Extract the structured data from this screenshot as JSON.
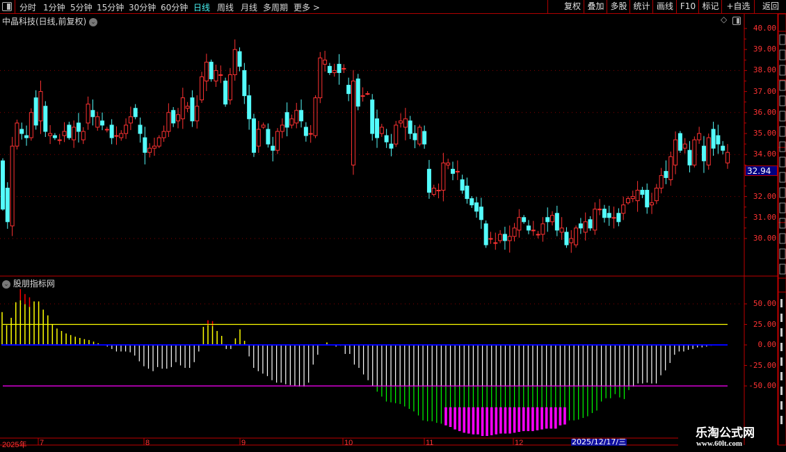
{
  "toolbar": {
    "period_tabs": [
      {
        "label": "分时",
        "active": false
      },
      {
        "label": "1分钟",
        "active": false
      },
      {
        "label": "5分钟",
        "active": false
      },
      {
        "label": "15分钟",
        "active": false
      },
      {
        "label": "30分钟",
        "active": false
      },
      {
        "label": "60分钟",
        "active": false
      },
      {
        "label": "日线",
        "active": true
      },
      {
        "label": "周线",
        "active": false
      },
      {
        "label": "月线",
        "active": false
      },
      {
        "label": "多周期",
        "active": false
      },
      {
        "label": "更多 >",
        "active": false
      }
    ],
    "right_buttons": [
      "复权",
      "叠加",
      "多股",
      "统计",
      "画线",
      "F10",
      "标记",
      "+自选",
      "返回"
    ]
  },
  "main_panel": {
    "title": "中晶科技(日线,前复权)",
    "price_ticks": [
      "40.00",
      "39.00",
      "38.00",
      "37.00",
      "36.00",
      "35.00",
      "34.00",
      "32.00",
      "31.00",
      "30.00"
    ],
    "current_price": "32.94",
    "colors": {
      "up": "#ff3232",
      "down": "#54fcfc",
      "grid": "#8b0000",
      "axis": "#c00000"
    }
  },
  "indicator_panel": {
    "title": "股朋指标网",
    "ticks": [
      "50.00",
      "25.00",
      "0.00",
      "-25.00",
      "-50.00"
    ],
    "colors": {
      "positive": "#ffff00",
      "tip": "#ff0000",
      "neutral": "#ffffff",
      "green": "#00ff00",
      "magenta": "#ff00ff",
      "zero_line": "#0000ff",
      "upper_line": "#ffff00",
      "lower_line": "#ff00ff"
    }
  },
  "date_axis": {
    "labels": [
      "2025年",
      "7",
      "8",
      "9",
      "10",
      "11",
      "12"
    ],
    "cursor_date": "2025/12/17/三"
  },
  "watermark": {
    "name": "乐淘公式网",
    "url": "www.60lt.com"
  },
  "chart_data": [
    {
      "type": "candlestick",
      "title": "中晶科技(日线,前复权)",
      "ylim": [
        29,
        40.2
      ],
      "fields": [
        "open",
        "close"
      ],
      "candles": [
        [
          33.7,
          31.4
        ],
        [
          32.4,
          30.8
        ],
        [
          30.6,
          34.4
        ],
        [
          34.4,
          35.5
        ],
        [
          35.2,
          35.0
        ],
        [
          34.9,
          34.8
        ],
        [
          34.8,
          36.0
        ],
        [
          36.7,
          35.4
        ],
        [
          35.6,
          37.0
        ],
        [
          36.3,
          35.1
        ],
        [
          34.9,
          35.0
        ],
        [
          34.9,
          34.8
        ],
        [
          34.7,
          34.7
        ],
        [
          34.9,
          35.1
        ],
        [
          35.4,
          34.8
        ],
        [
          34.7,
          35.3
        ],
        [
          35.5,
          35.1
        ],
        [
          34.7,
          35.1
        ],
        [
          35.5,
          36.4
        ],
        [
          36.1,
          35.8
        ],
        [
          35.3,
          35.8
        ],
        [
          35.6,
          35.4
        ],
        [
          35.2,
          35.2
        ],
        [
          35.4,
          34.8
        ],
        [
          34.9,
          34.9
        ],
        [
          34.8,
          35.0
        ],
        [
          35.0,
          35.4
        ],
        [
          35.5,
          35.8
        ],
        [
          36.2,
          35.8
        ],
        [
          35.4,
          35.0
        ],
        [
          34.8,
          34.1
        ],
        [
          34.1,
          34.3
        ],
        [
          34.3,
          34.4
        ],
        [
          34.4,
          34.8
        ],
        [
          34.8,
          35.1
        ],
        [
          35.1,
          36.0
        ],
        [
          36.1,
          35.5
        ],
        [
          35.6,
          35.9
        ],
        [
          35.7,
          36.7
        ],
        [
          36.2,
          36.3
        ],
        [
          36.7,
          35.6
        ],
        [
          35.6,
          36.3
        ],
        [
          36.6,
          37.7
        ],
        [
          37.5,
          38.4
        ],
        [
          38.4,
          37.6
        ],
        [
          37.5,
          38.0
        ],
        [
          37.8,
          37.8
        ],
        [
          37.5,
          36.4
        ],
        [
          36.6,
          37.8
        ],
        [
          37.8,
          39.0
        ],
        [
          38.9,
          38.2
        ],
        [
          38.0,
          36.8
        ],
        [
          36.8,
          35.7
        ],
        [
          35.7,
          34.1
        ],
        [
          34.4,
          35.2
        ],
        [
          35.3,
          35.4
        ],
        [
          35.2,
          34.5
        ],
        [
          34.4,
          34.2
        ],
        [
          34.2,
          35.1
        ],
        [
          35.1,
          35.4
        ],
        [
          36.0,
          35.3
        ],
        [
          35.4,
          35.7
        ],
        [
          35.5,
          36.1
        ],
        [
          36.1,
          35.6
        ],
        [
          35.3,
          34.9
        ],
        [
          35.0,
          35.0
        ],
        [
          34.9,
          36.7
        ],
        [
          36.7,
          38.6
        ],
        [
          38.3,
          38.5
        ],
        [
          38.2,
          37.9
        ],
        [
          37.9,
          38.0
        ],
        [
          38.3,
          37.9
        ],
        [
          38.1,
          38.1
        ],
        [
          37.3,
          36.9
        ],
        [
          33.5,
          37.5
        ],
        [
          37.6,
          36.3
        ],
        [
          36.8,
          36.8
        ],
        [
          36.9,
          36.9
        ],
        [
          36.6,
          35.0
        ],
        [
          35.7,
          34.8
        ],
        [
          35.0,
          35.3
        ],
        [
          34.9,
          34.6
        ],
        [
          34.5,
          34.3
        ],
        [
          34.5,
          35.4
        ],
        [
          35.5,
          35.6
        ],
        [
          35.3,
          35.7
        ],
        [
          35.6,
          35.0
        ],
        [
          35.0,
          34.7
        ],
        [
          34.5,
          35.3
        ],
        [
          35.1,
          34.5
        ],
        [
          33.3,
          32.2
        ],
        [
          32.1,
          32.4
        ],
        [
          32.3,
          32.3
        ],
        [
          32.3,
          33.6
        ],
        [
          33.5,
          33.6
        ],
        [
          33.3,
          33.1
        ],
        [
          33.2,
          33.2
        ],
        [
          32.8,
          32.3
        ],
        [
          32.5,
          31.9
        ],
        [
          31.9,
          31.6
        ],
        [
          31.7,
          31.3
        ],
        [
          31.5,
          30.9
        ],
        [
          30.7,
          29.7
        ],
        [
          30.0,
          30.0
        ],
        [
          29.8,
          29.8
        ],
        [
          29.9,
          30.2
        ],
        [
          30.2,
          29.9
        ],
        [
          29.9,
          30.1
        ],
        [
          30.1,
          30.5
        ],
        [
          30.4,
          31.0
        ],
        [
          31.0,
          30.8
        ],
        [
          30.6,
          30.4
        ],
        [
          30.4,
          30.4
        ],
        [
          30.2,
          30.2
        ],
        [
          30.2,
          30.7
        ],
        [
          31.0,
          30.8
        ],
        [
          30.8,
          31.1
        ],
        [
          31.2,
          30.4
        ],
        [
          30.3,
          30.5
        ],
        [
          30.3,
          29.7
        ],
        [
          29.8,
          30.0
        ],
        [
          29.7,
          30.5
        ],
        [
          30.7,
          30.5
        ],
        [
          30.3,
          30.8
        ],
        [
          30.9,
          30.5
        ],
        [
          30.4,
          31.4
        ],
        [
          31.4,
          31.4
        ],
        [
          31.4,
          31.0
        ],
        [
          31.2,
          31.0
        ],
        [
          31.0,
          31.0
        ],
        [
          31.2,
          30.8
        ],
        [
          31.2,
          31.6
        ],
        [
          31.7,
          31.9
        ],
        [
          31.9,
          32.0
        ],
        [
          31.8,
          32.3
        ],
        [
          32.3,
          32.1
        ],
        [
          32.3,
          31.5
        ],
        [
          31.6,
          31.7
        ],
        [
          31.8,
          32.4
        ],
        [
          32.4,
          33.0
        ],
        [
          33.2,
          32.9
        ],
        [
          32.8,
          33.9
        ],
        [
          33.5,
          34.7
        ],
        [
          35.0,
          34.2
        ],
        [
          34.3,
          34.5
        ],
        [
          34.2,
          33.5
        ],
        [
          33.5,
          34.7
        ],
        [
          34.7,
          35.0
        ],
        [
          34.4,
          33.7
        ],
        [
          33.5,
          34.8
        ],
        [
          35.2,
          34.3
        ],
        [
          34.9,
          34.5
        ],
        [
          34.4,
          34.2
        ],
        [
          33.6,
          34.1
        ]
      ]
    },
    {
      "type": "bar",
      "title": "股朋指标网",
      "ylim": [
        -120,
        75
      ],
      "reference_lines": [
        25,
        0,
        -50
      ],
      "red_tip_indices": [
        4,
        5,
        6,
        45,
        46
      ],
      "values": [
        40,
        24,
        33,
        52,
        68,
        62,
        58,
        53,
        53,
        43,
        36,
        25,
        20,
        17,
        14,
        12,
        10,
        8.5,
        7,
        6,
        4,
        2,
        0,
        -2,
        -5,
        -8,
        -8,
        -8,
        -9,
        -13,
        -20,
        -26,
        -29,
        -32,
        -27,
        -29,
        -29,
        -27,
        -21,
        -25,
        -28,
        -28,
        -21,
        -8,
        22,
        30,
        29,
        17,
        11,
        -5,
        -5,
        8,
        19,
        5,
        -14,
        -28,
        -32,
        -35,
        -38,
        -43,
        -46,
        -46,
        -48,
        -49,
        -50,
        -51,
        -51,
        -46,
        -24,
        -12,
        0,
        3,
        0,
        -2,
        -1,
        -11,
        -11,
        -24,
        -28,
        -36,
        -43,
        -50,
        -57,
        -63,
        -69,
        -70,
        -71,
        -72,
        -75,
        -78,
        -81,
        -86,
        -92,
        -93,
        -93,
        -95,
        -96,
        -98,
        -100,
        -103,
        -105,
        -107,
        -108,
        -109,
        -109,
        -111,
        -111,
        -110,
        -109,
        -108,
        -108,
        -108,
        -107,
        -106,
        -105,
        -105,
        -105,
        -104,
        -103,
        -102,
        -102,
        -102,
        -98,
        -97,
        -92,
        -92,
        -91,
        -89,
        -87,
        -83,
        -80,
        -69,
        -65,
        -65,
        -60,
        -64,
        -66,
        -55,
        -51,
        -47,
        -47,
        -46,
        -47,
        -47,
        -37,
        -31,
        -22,
        -12,
        -8,
        -8,
        -6,
        -5,
        -3,
        -3,
        -2,
        -1,
        0
      ]
    }
  ]
}
